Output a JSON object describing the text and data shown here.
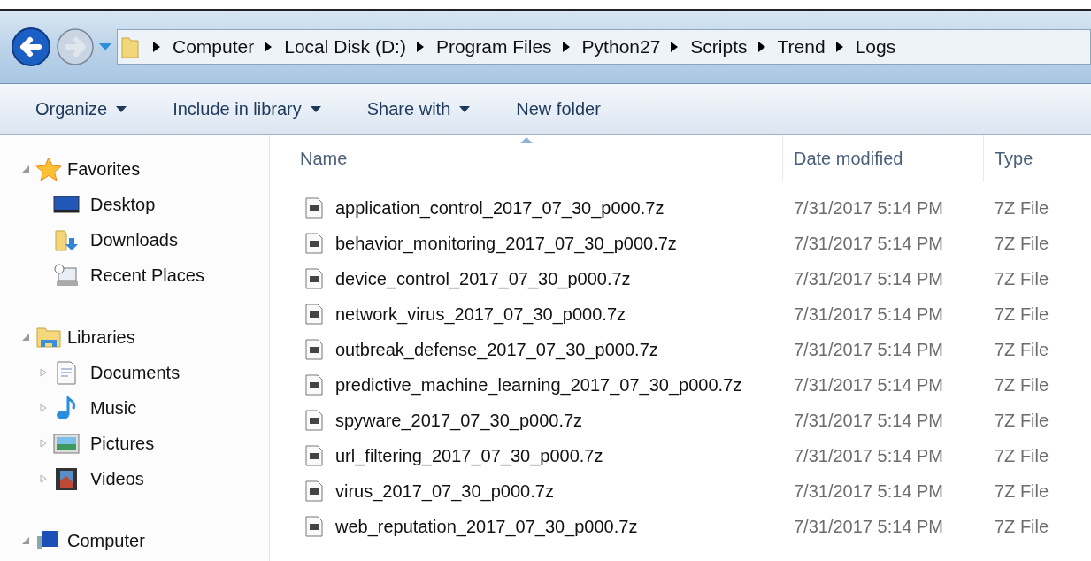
{
  "navigation": {
    "breadcrumb": [
      "Computer",
      "Local Disk (D:)",
      "Program Files",
      "Python27",
      "Scripts",
      "Trend",
      "Logs"
    ],
    "forward_disabled": true
  },
  "toolbar": [
    {
      "label": "Organize",
      "dropdown": true
    },
    {
      "label": "Include in library",
      "dropdown": true
    },
    {
      "label": "Share with",
      "dropdown": true
    },
    {
      "label": "New folder",
      "dropdown": false
    }
  ],
  "sidebar": {
    "groups": [
      {
        "label": "Favorites",
        "expanded": true,
        "children": [
          {
            "label": "Desktop",
            "expandable": false
          },
          {
            "label": "Downloads",
            "expandable": false
          },
          {
            "label": "Recent Places",
            "expandable": false
          }
        ]
      },
      {
        "label": "Libraries",
        "expanded": true,
        "children": [
          {
            "label": "Documents",
            "expandable": true
          },
          {
            "label": "Music",
            "expandable": true
          },
          {
            "label": "Pictures",
            "expandable": true
          },
          {
            "label": "Videos",
            "expandable": true
          }
        ]
      },
      {
        "label": "Computer",
        "expanded": true
      }
    ]
  },
  "file_list": {
    "columns": [
      {
        "label": "Name",
        "sorted": true
      },
      {
        "label": "Date modified",
        "sorted": false
      },
      {
        "label": "Type",
        "sorted": false
      }
    ],
    "rows": [
      {
        "name": "application_control_2017_07_30_p000.7z",
        "date": "7/31/2017 5:14 PM",
        "type": "7Z File"
      },
      {
        "name": "behavior_monitoring_2017_07_30_p000.7z",
        "date": "7/31/2017 5:14 PM",
        "type": "7Z File"
      },
      {
        "name": "device_control_2017_07_30_p000.7z",
        "date": "7/31/2017 5:14 PM",
        "type": "7Z File"
      },
      {
        "name": "network_virus_2017_07_30_p000.7z",
        "date": "7/31/2017 5:14 PM",
        "type": "7Z File"
      },
      {
        "name": "outbreak_defense_2017_07_30_p000.7z",
        "date": "7/31/2017 5:14 PM",
        "type": "7Z File"
      },
      {
        "name": "predictive_machine_learning_2017_07_30_p000.7z",
        "date": "7/31/2017 5:14 PM",
        "type": "7Z File"
      },
      {
        "name": "spyware_2017_07_30_p000.7z",
        "date": "7/31/2017 5:14 PM",
        "type": "7Z File"
      },
      {
        "name": "url_filtering_2017_07_30_p000.7z",
        "date": "7/31/2017 5:14 PM",
        "type": "7Z File"
      },
      {
        "name": "virus_2017_07_30_p000.7z",
        "date": "7/31/2017 5:14 PM",
        "type": "7Z File"
      },
      {
        "name": "web_reputation_2017_07_30_p000.7z",
        "date": "7/31/2017 5:14 PM",
        "type": "7Z File"
      }
    ]
  }
}
